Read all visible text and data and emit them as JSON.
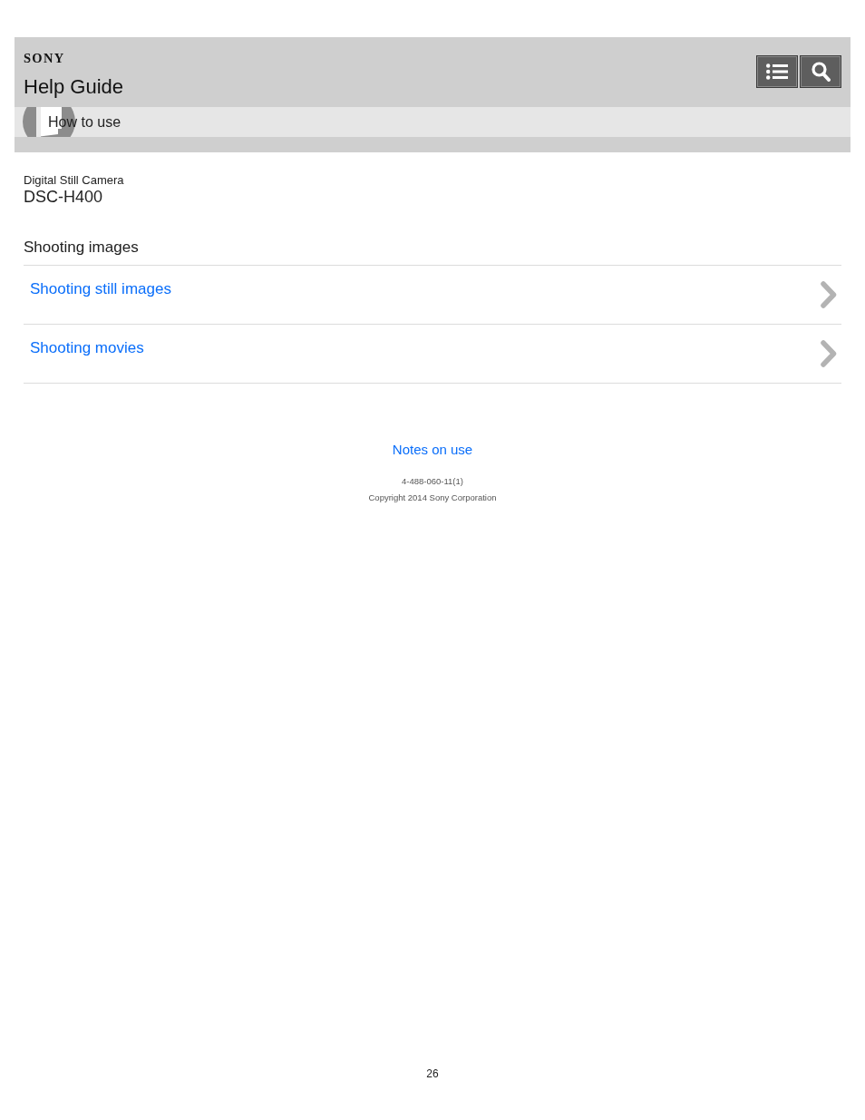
{
  "header": {
    "logo": "SONY",
    "title": "Help Guide",
    "buttons": [
      {
        "kind": "menu"
      },
      {
        "kind": "search"
      }
    ]
  },
  "breadcrumb": {
    "label": "How to use"
  },
  "product": {
    "category": "Digital Still Camera",
    "model": "DSC-H400"
  },
  "section": {
    "title": "Shooting images",
    "links": [
      {
        "label": "Shooting still images"
      },
      {
        "label": "Shooting movies"
      }
    ]
  },
  "footer": {
    "link": "Notes on use",
    "code": "4-488-060-11(1)",
    "copyright": "Copyright 2014 Sony Corporation",
    "page_number": "26"
  }
}
